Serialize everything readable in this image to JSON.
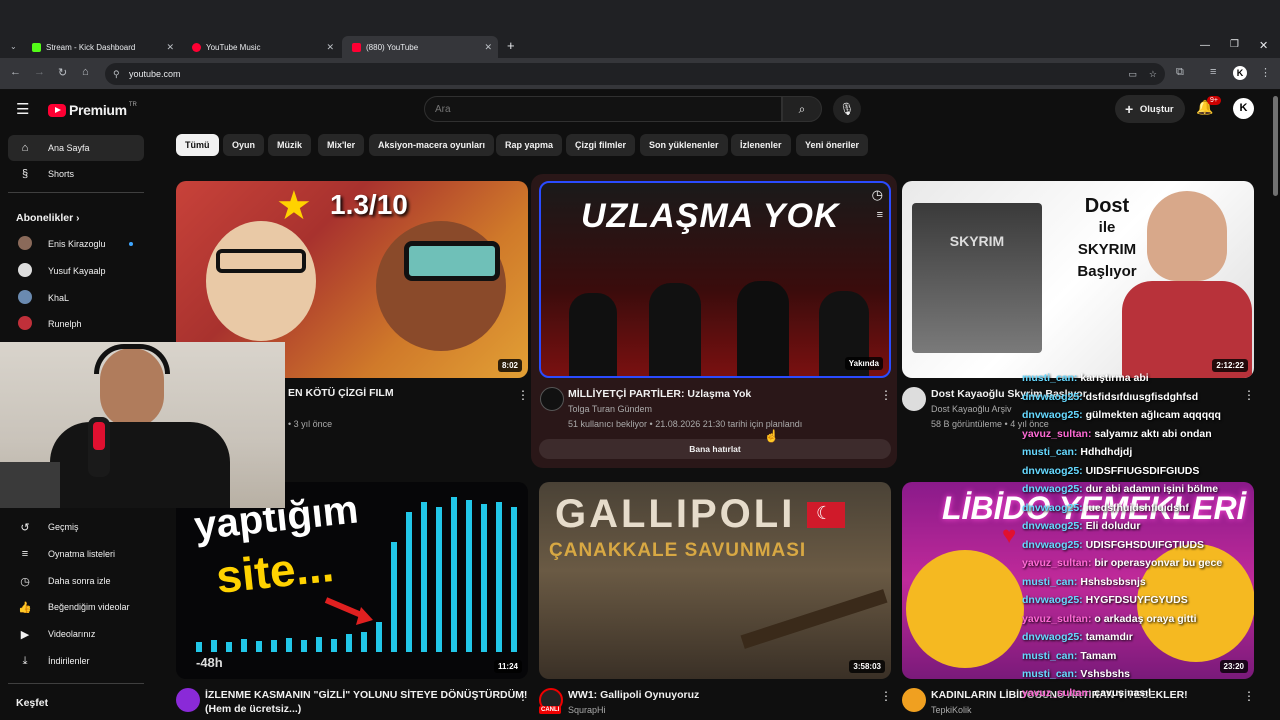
{
  "browser": {
    "tabs": [
      {
        "label": "Stream - Kick Dashboard",
        "color": "#53fc18"
      },
      {
        "label": "YouTube Music",
        "color": "#ff0033"
      },
      {
        "label": "(880) YouTube",
        "color": "#ff0033"
      }
    ],
    "url": "youtube.com"
  },
  "yt": {
    "logo": "Premium",
    "region": "TR",
    "search_placeholder": "Ara",
    "create_label": "Oluştur",
    "notif_count": "9+",
    "account_initial": "K"
  },
  "sidebar": {
    "home": "Ana Sayfa",
    "shorts": "Shorts",
    "subs_title": "Abonelikler",
    "subs": [
      "Enis Kirazoglu",
      "Yusuf Kayaalp",
      "KhaL",
      "Runelph"
    ],
    "you": [
      "Geçmiş",
      "Oynatma listeleri",
      "Daha sonra izle",
      "Beğendiğim videolar",
      "Videolarınız",
      "İndirilenler"
    ],
    "explore": "Keşfet"
  },
  "chips": [
    "Tümü",
    "Oyun",
    "Müzik",
    "Mix'ler",
    "Aksiyon-macera oyunları",
    "Rap yapma",
    "Çizgi filmler",
    "Son yüklenenler",
    "İzlenenler",
    "Yeni öneriler"
  ],
  "videos": [
    {
      "thumb_text": "1.3/10",
      "duration": "8:02",
      "title": "EN KÖTÜ ÇİZGİ FILM",
      "meta": "• 3 yıl önce"
    },
    {
      "thumb_text": "UZLAŞMA YOK",
      "duration": "Yakında",
      "title": "MİLLİYETÇİ PARTİLER: Uzlaşma Yok",
      "channel": "Tolga Turan Gündem",
      "meta": "51 kullanıcı bekliyor • 21.08.2026 21:30 tarihi için planlandı",
      "button": "Bana hatırlat"
    },
    {
      "thumb_text_1": "Dost",
      "thumb_text_2": "ile",
      "thumb_text_3": "SKYRIM",
      "thumb_text_4": "Başlıyor",
      "box_text": "SKYRIM",
      "duration": "2:12:22",
      "title": "Dost Kayaoğlu Skyrim Başlıyor",
      "channel": "Dost Kayaoğlu Arşiv",
      "meta": "58 B görüntüleme • 4 yıl önce"
    },
    {
      "thumb_text_1": "yaptığım",
      "thumb_text_2": "site...",
      "overlay": "-48h",
      "duration": "11:24",
      "title": "İZLENME KASMANIN \"GİZLİ\" YOLUNU SİTEYE DÖNÜŞTÜRDÜM!",
      "title2": "(Hem de ücretsiz...)"
    },
    {
      "thumb_text_1": "GALLIPOLI",
      "thumb_text_2": "ÇANAKKALE SAVUNMASI",
      "duration": "3:58:03",
      "title": "WW1: Gallipoli Oynuyoruz",
      "channel": "SqurapHi",
      "badge": "CANLI"
    },
    {
      "thumb_text": "LİBİDO YEMEKLERİ",
      "duration": "23:20",
      "title": "KADINLARIN LİBİDOSUNU ARTIRAN YİYECEKLER!",
      "channel": "TepkiKolik"
    }
  ],
  "chat": [
    {
      "user": "musti_can:",
      "msg": "karıştırma abi",
      "u": "u1"
    },
    {
      "user": "dnvwaog25:",
      "msg": "dsfidsıfdıusgfisdghfsd",
      "u": "u1"
    },
    {
      "user": "dnvwaog25:",
      "msg": "gülmekten ağlıcam aqqqqq",
      "u": "u1"
    },
    {
      "user": "yavuz_sultan:",
      "msg": "salyamız aktı abi ondan",
      "u": "u3"
    },
    {
      "user": "musti_can:",
      "msg": "Hdhdhdjdj",
      "u": "u1"
    },
    {
      "user": "dnvwaog25:",
      "msg": "UIDSFFIUGSDIFGIUDS",
      "u": "u1"
    },
    {
      "user": "dnvwaog25:",
      "msg": "dur abi adamın işini bölme",
      "u": "u1"
    },
    {
      "user": "dnvwaog25:",
      "msg": "iuedsfhuidshfiuidshf",
      "u": "u1"
    },
    {
      "user": "dnvwaog25:",
      "msg": "Eli doludur",
      "u": "u1"
    },
    {
      "user": "dnvwaog25:",
      "msg": "UDISFGHSDUIFGTIUDS",
      "u": "u1"
    },
    {
      "user": "yavuz_sultan:",
      "msg": "bir operasyonvar bu gece",
      "u": "u3"
    },
    {
      "user": "musti_can:",
      "msg": "Hshsbsbsnjs",
      "u": "u1"
    },
    {
      "user": "dnvwaog25:",
      "msg": "HYGFDSUYFGYUDS",
      "u": "u1"
    },
    {
      "user": "yavuz_sultan:",
      "msg": "o arkadaş oraya gitti",
      "u": "u3"
    },
    {
      "user": "dnvwaog25:",
      "msg": "tamamdır",
      "u": "u1"
    },
    {
      "user": "musti_can:",
      "msg": "Tamam",
      "u": "u1"
    },
    {
      "user": "musti_can:",
      "msg": "Vshsbshs",
      "u": "u1"
    },
    {
      "user": "yavuz_sultan:",
      "msg": "çavuş nasıl",
      "u": "u3"
    }
  ]
}
